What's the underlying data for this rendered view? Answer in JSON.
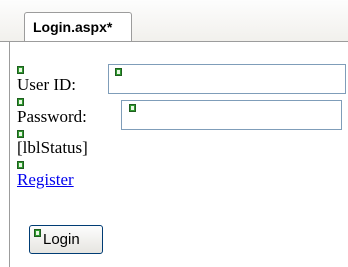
{
  "tab": {
    "title": "Login.aspx*"
  },
  "form": {
    "user_id_label": "User ID:",
    "user_id_value": "",
    "password_label": "Password:",
    "password_value": "",
    "status_label": "[lblStatus]",
    "register_link": "Register",
    "login_button": "Login"
  },
  "colors": {
    "link": "#0000ee",
    "control_glyph": "#2f9a2f",
    "textbox_border": "#7f9db9",
    "button_border": "#003c74"
  },
  "icons": {
    "control_glyph": "server-control-glyph-icon"
  }
}
